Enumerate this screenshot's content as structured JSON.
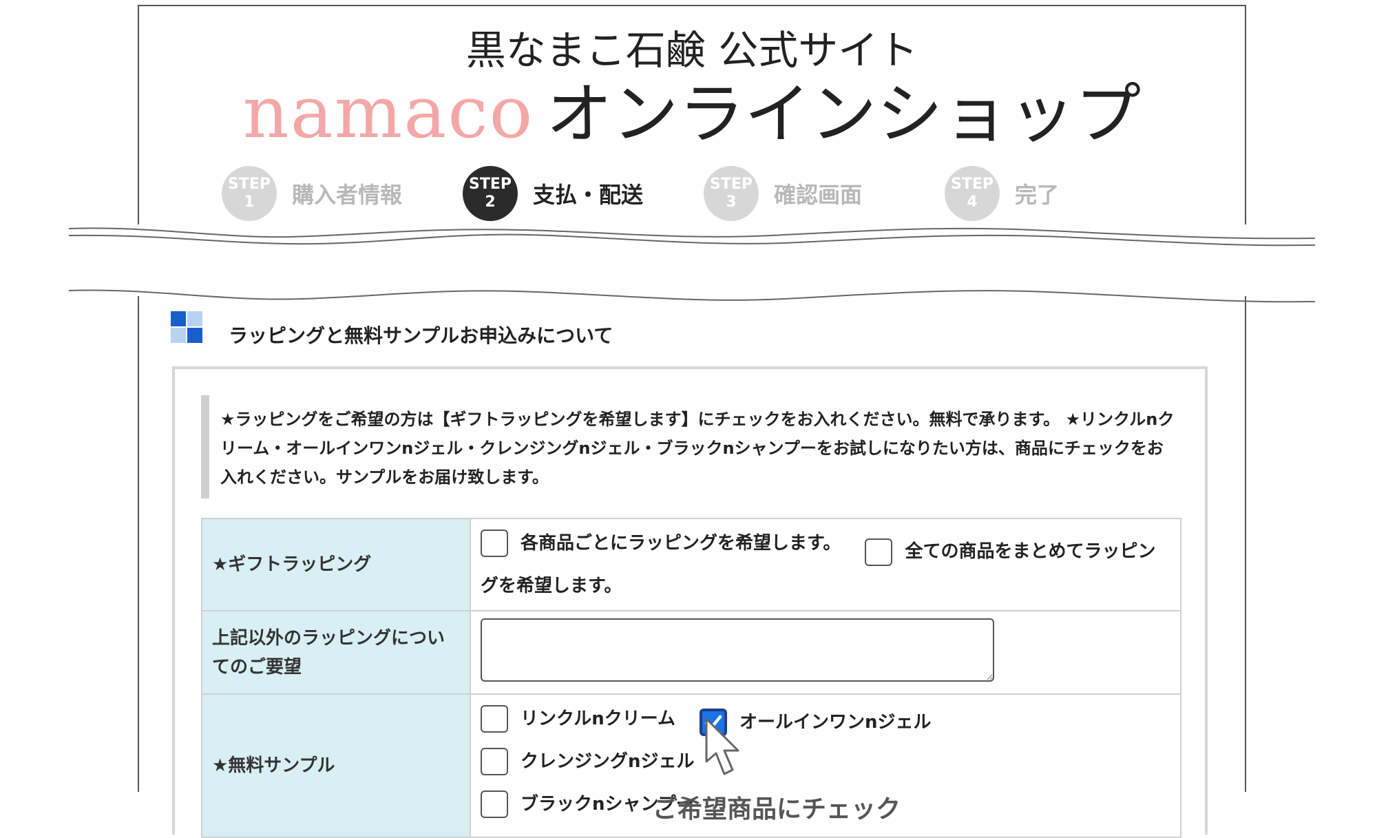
{
  "header": {
    "subtitle": "黒なまこ石鹸 公式サイト",
    "brand": "namaco",
    "shop": "オンラインショップ"
  },
  "steps": [
    {
      "word": "STEP",
      "num": "1",
      "label": "購入者情報",
      "active": false
    },
    {
      "word": "STEP",
      "num": "2",
      "label": "支払・配送",
      "active": true
    },
    {
      "word": "STEP",
      "num": "3",
      "label": "確認画面",
      "active": false
    },
    {
      "word": "STEP",
      "num": "4",
      "label": "完了",
      "active": false
    }
  ],
  "section": {
    "title": "ラッピングと無料サンプルお申込みについて",
    "note": "★ラッピングをご希望の方は【ギフトラッピングを希望します】にチェックをお入れください。無料で承ります。 ★リンクルnクリーム・オールインワンnジェル・クレンジングnジェル・ブラックnシャンプーをお試しになりたい方は、商品にチェックをお入れください。サンプルをお届け致します。"
  },
  "form": {
    "gift": {
      "label": "★ギフトラッピング",
      "options": [
        {
          "label": "各商品ごとにラッピングを希望します。",
          "checked": false
        },
        {
          "label": "全ての商品をまとめてラッピングを希望します。",
          "checked": false
        }
      ]
    },
    "request": {
      "label": "上記以外のラッピングについてのご要望",
      "value": ""
    },
    "sample": {
      "label": "★無料サンプル",
      "options": [
        {
          "label": "リンクルnクリーム",
          "checked": false
        },
        {
          "label": "オールインワンnジェル",
          "checked": true
        },
        {
          "label": "クレンジングnジェル",
          "checked": false
        },
        {
          "label": "ブラックnシャンプー",
          "checked": false
        }
      ]
    }
  },
  "caption": "ご希望商品にチェック",
  "colors": {
    "brand_pink": "#f4a7a7",
    "label_bg": "#d8eff3",
    "check_blue": "#1a73e8",
    "step_active": "#2b2b2b",
    "step_inactive": "#d7d7d7"
  },
  "icons": {
    "section": "blue-squares-icon",
    "checkmark": "checkmark-icon",
    "cursor": "mouse-pointer-icon"
  }
}
